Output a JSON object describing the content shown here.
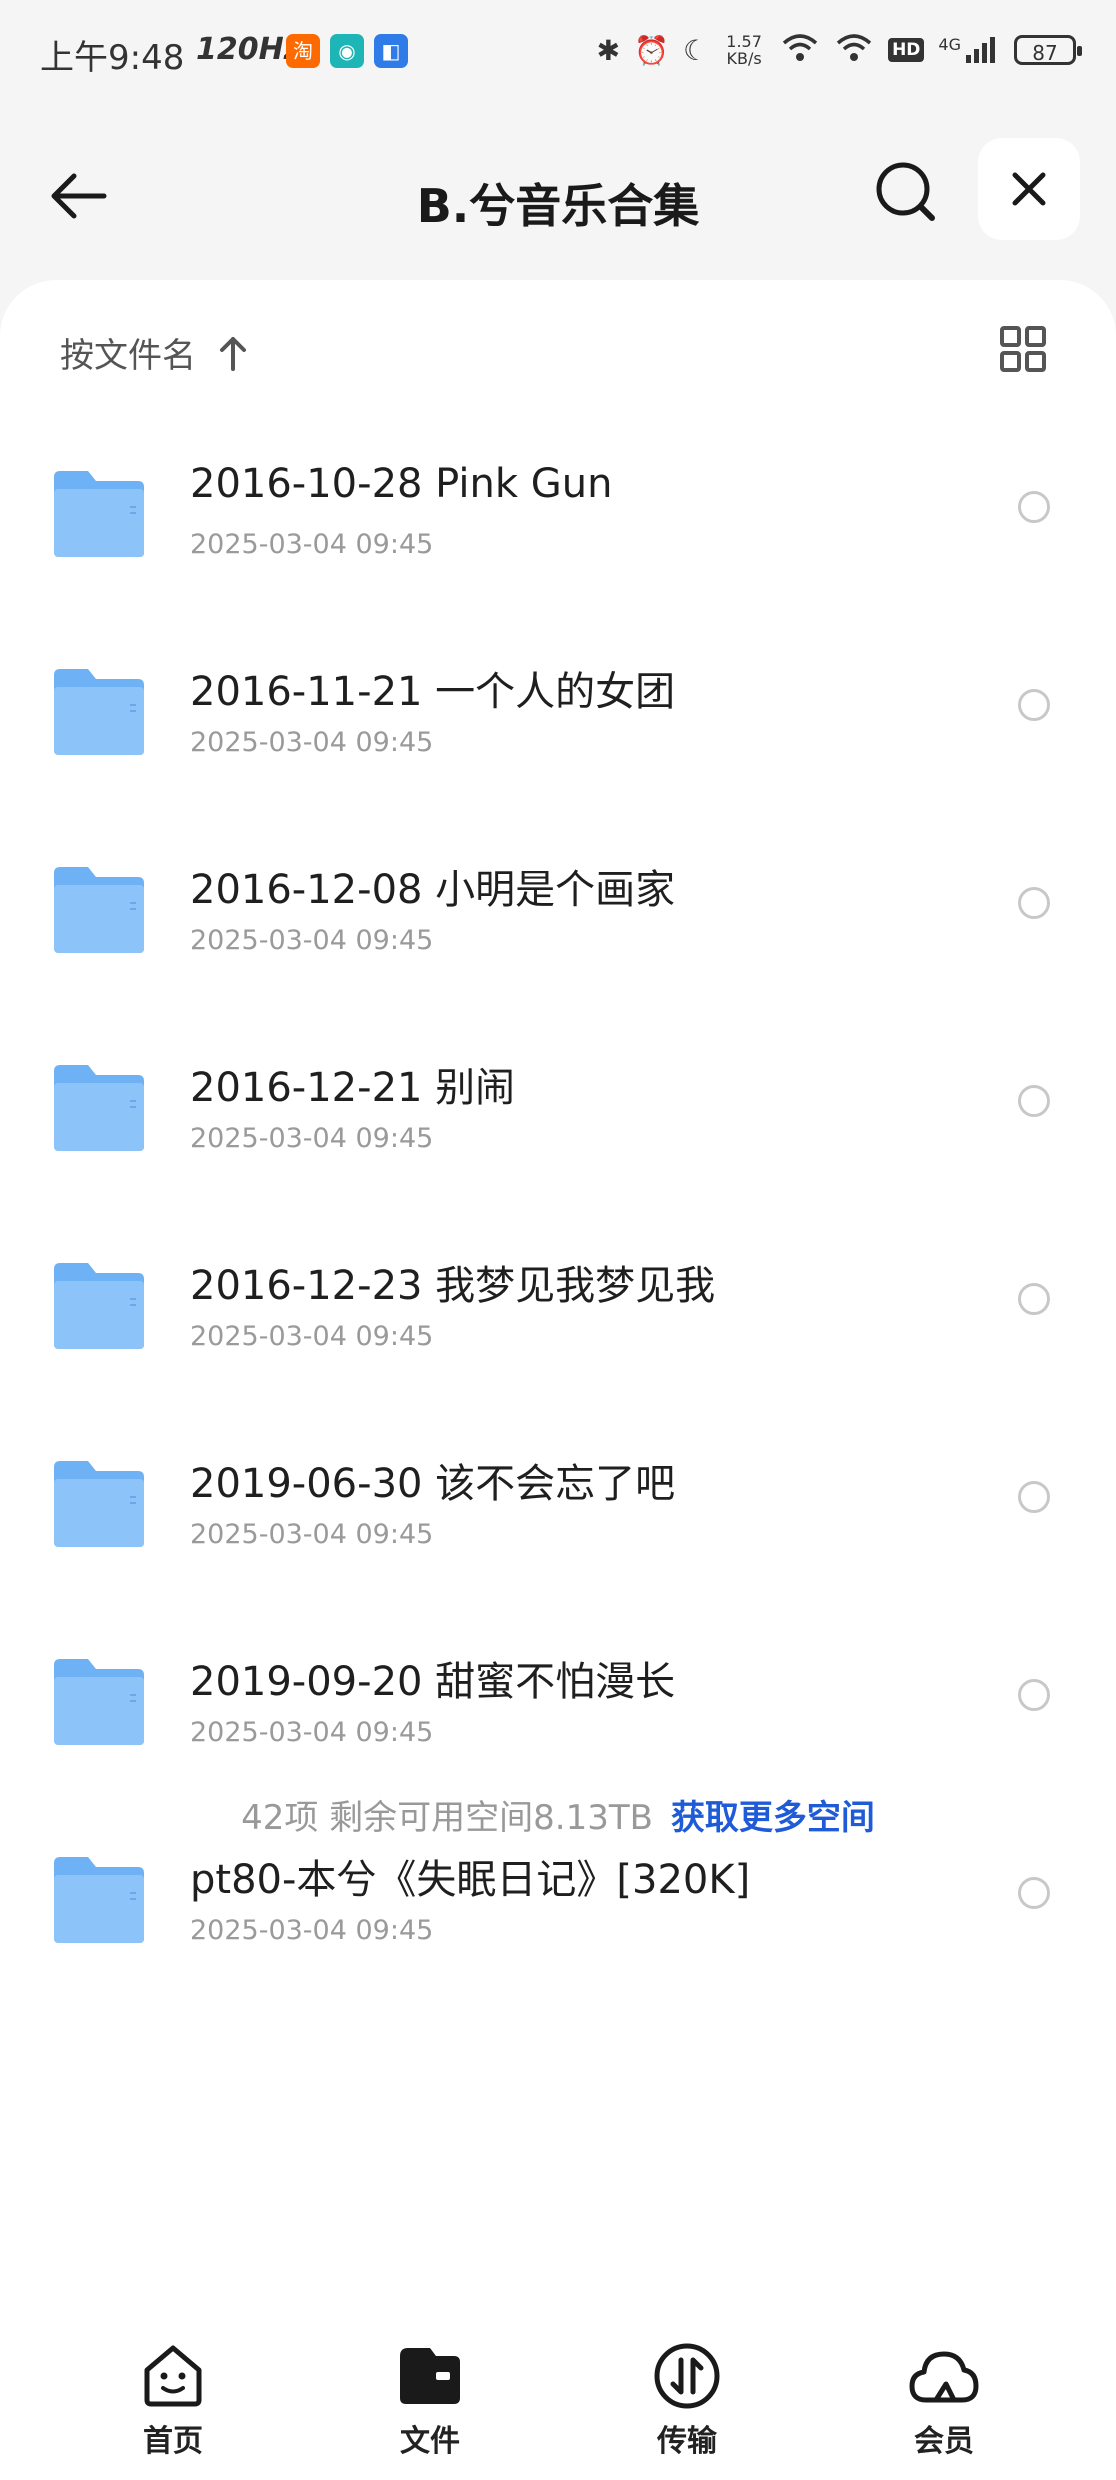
{
  "status": {
    "time": "上午9:48",
    "refresh": "120Hz",
    "app_icons": [
      {
        "name": "taobao-icon",
        "glyph": "淘",
        "color": "#ff6a00"
      },
      {
        "name": "app-icon-teal",
        "glyph": "◉",
        "color": "#1db5b5"
      },
      {
        "name": "app-icon-blue",
        "glyph": "◧",
        "color": "#2f7be8"
      }
    ],
    "net_speed": "1.57 KB/s",
    "hd": "HD",
    "network": "4G",
    "battery": "87"
  },
  "header": {
    "title": "B.兮音乐合集"
  },
  "sort": {
    "label": "按文件名"
  },
  "files": [
    {
      "name": "2016-10-28 Pink Gun",
      "date": "2025-03-04 09:45"
    },
    {
      "name": "2016-11-21 一个人的女团",
      "date": "2025-03-04 09:45"
    },
    {
      "name": "2016-12-08 小明是个画家",
      "date": "2025-03-04 09:45"
    },
    {
      "name": "2016-12-21 别闹",
      "date": "2025-03-04 09:45"
    },
    {
      "name": "2016-12-23 我梦见我梦见我",
      "date": "2025-03-04 09:45"
    },
    {
      "name": "2019-06-30 该不会忘了吧",
      "date": "2025-03-04 09:45"
    },
    {
      "name": "2019-09-20 甜蜜不怕漫长",
      "date": "2025-03-04 09:45"
    },
    {
      "name": "pt80-本兮《失眠日记》[320K]",
      "date": "2025-03-04 09:45"
    }
  ],
  "footer": {
    "info": "42项 剩余可用空间8.13TB",
    "more_link": "获取更多空间"
  },
  "tabs": [
    {
      "label": "首页",
      "icon": "home-smile-icon"
    },
    {
      "label": "文件",
      "icon": "folder-wallet-icon"
    },
    {
      "label": "传输",
      "icon": "transfer-icon"
    },
    {
      "label": "会员",
      "icon": "cloud-icon"
    }
  ],
  "colors": {
    "accent": "#1f5bd6",
    "folder": "#6fb1f5"
  }
}
